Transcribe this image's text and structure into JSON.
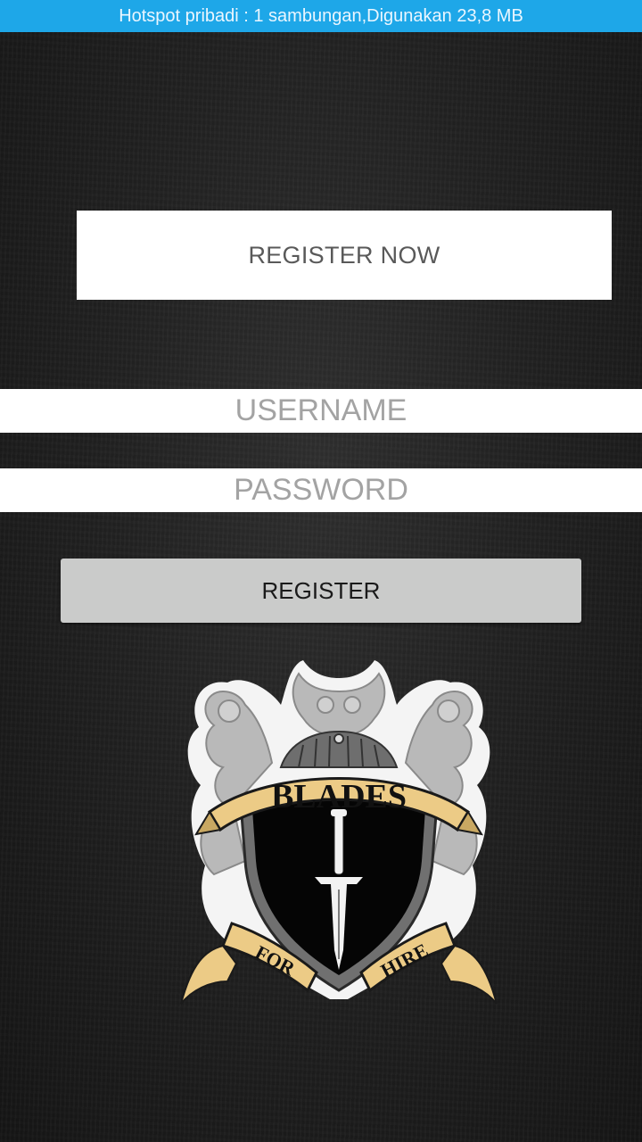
{
  "status_bar": {
    "text": "Hotspot pribadi : 1 sambungan,Digunakan 23,8 MB"
  },
  "register_now": {
    "label": "REGISTER NOW"
  },
  "form": {
    "username_placeholder": "USERNAME",
    "password_placeholder": "PASSWORD",
    "register_label": "REGISTER"
  },
  "logo": {
    "text_top": "BLADES",
    "text_left": "FOR",
    "text_right": "HIRE",
    "icon": "blades-for-hire-crest"
  },
  "colors": {
    "status_bar": "#1ea7e8",
    "button": "#cacbca",
    "banner": "#eccb86"
  }
}
